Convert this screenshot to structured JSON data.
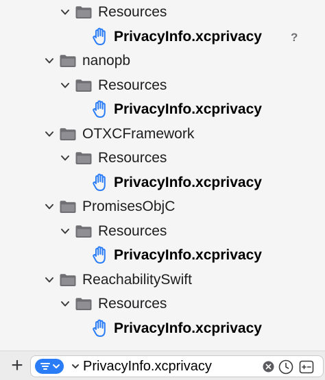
{
  "tree": [
    {
      "kind": "folder",
      "label": "Resources",
      "indent": 1,
      "expanded": true,
      "icon": "folder-icon"
    },
    {
      "kind": "file",
      "label": "PrivacyInfo.xcprivacy",
      "indent": 2,
      "icon": "hand-raised-icon",
      "status": "?"
    },
    {
      "kind": "folder",
      "label": "nanopb",
      "indent": 0,
      "expanded": true,
      "icon": "folder-icon"
    },
    {
      "kind": "folder",
      "label": "Resources",
      "indent": 1,
      "expanded": true,
      "icon": "folder-icon"
    },
    {
      "kind": "file",
      "label": "PrivacyInfo.xcprivacy",
      "indent": 2,
      "icon": "hand-raised-icon"
    },
    {
      "kind": "folder",
      "label": "OTXCFramework",
      "indent": 0,
      "expanded": true,
      "icon": "folder-icon"
    },
    {
      "kind": "folder",
      "label": "Resources",
      "indent": 1,
      "expanded": true,
      "icon": "folder-icon"
    },
    {
      "kind": "file",
      "label": "PrivacyInfo.xcprivacy",
      "indent": 2,
      "icon": "hand-raised-icon"
    },
    {
      "kind": "folder",
      "label": "PromisesObjC",
      "indent": 0,
      "expanded": true,
      "icon": "folder-icon"
    },
    {
      "kind": "folder",
      "label": "Resources",
      "indent": 1,
      "expanded": true,
      "icon": "folder-icon"
    },
    {
      "kind": "file",
      "label": "PrivacyInfo.xcprivacy",
      "indent": 2,
      "icon": "hand-raised-icon"
    },
    {
      "kind": "folder",
      "label": "ReachabilitySwift",
      "indent": 0,
      "expanded": true,
      "icon": "folder-icon"
    },
    {
      "kind": "folder",
      "label": "Resources",
      "indent": 1,
      "expanded": true,
      "icon": "folder-icon"
    },
    {
      "kind": "file",
      "label": "PrivacyInfo.xcprivacy",
      "indent": 2,
      "icon": "hand-raised-icon"
    }
  ],
  "filter_bar": {
    "add_label": "+",
    "search_value": "PrivacyInfo.xcprivacy",
    "icons": {
      "add": "plus-icon",
      "filter": "filter-icon",
      "scope": "chevron-down-icon",
      "clear": "clear-icon",
      "recent": "clock-icon",
      "scm": "scm-changes-icon"
    },
    "accent_color": "#2a7df6"
  },
  "colors": {
    "icon_color": "#2a7df6",
    "folder_color": "#6e6e73",
    "text_color": "#1d1d1f"
  }
}
